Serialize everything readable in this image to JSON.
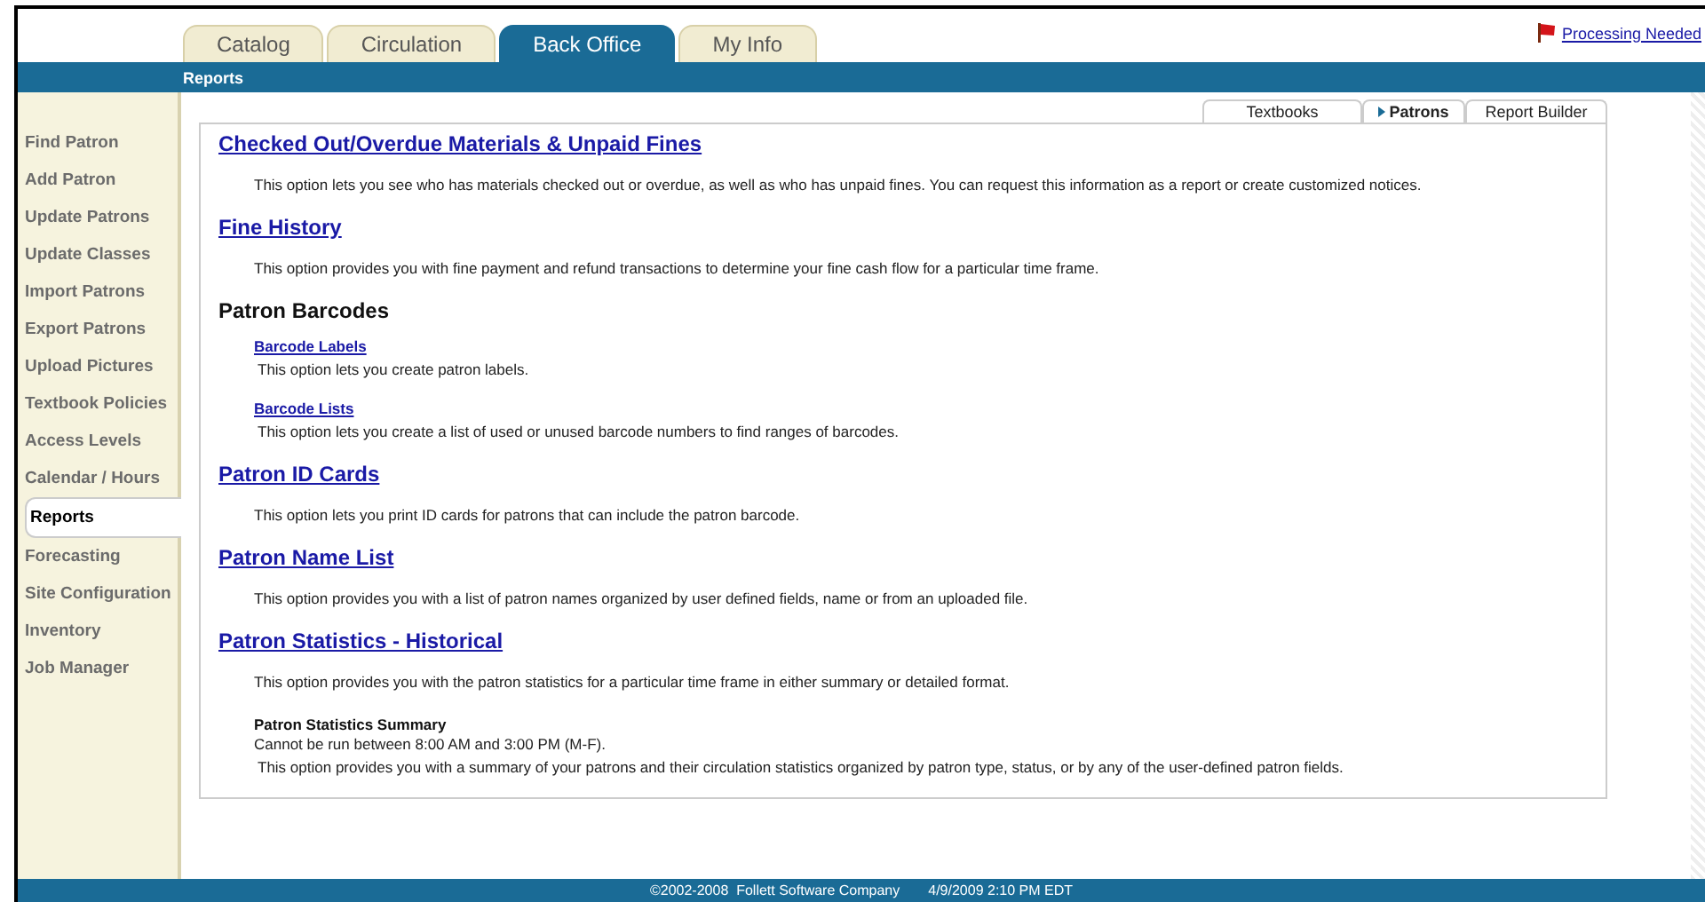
{
  "tabs": [
    {
      "label": "Catalog",
      "selected": false
    },
    {
      "label": "Circulation",
      "selected": false
    },
    {
      "label": "Back Office",
      "selected": true
    },
    {
      "label": "My Info",
      "selected": false
    }
  ],
  "alert_link": "Processing Needed",
  "subnav": "Reports",
  "sidebar": {
    "items": [
      {
        "label": "Find Patron",
        "selected": false
      },
      {
        "label": "Add Patron",
        "selected": false
      },
      {
        "label": "Update Patrons",
        "selected": false
      },
      {
        "label": "Update Classes",
        "selected": false
      },
      {
        "label": "Import Patrons",
        "selected": false
      },
      {
        "label": "Export Patrons",
        "selected": false
      },
      {
        "label": "Upload Pictures",
        "selected": false
      },
      {
        "label": "Textbook Policies",
        "selected": false
      },
      {
        "label": "Access Levels",
        "selected": false
      },
      {
        "label": "Calendar / Hours",
        "selected": false
      },
      {
        "label": "Reports",
        "selected": true
      },
      {
        "label": "Forecasting",
        "selected": false
      },
      {
        "label": "Site Configuration",
        "selected": false
      },
      {
        "label": "Inventory",
        "selected": false
      },
      {
        "label": "Job Manager",
        "selected": false
      }
    ]
  },
  "report_tabs": [
    {
      "label": "Textbooks",
      "selected": false
    },
    {
      "label": "Patrons",
      "selected": true
    },
    {
      "label": "Report Builder",
      "selected": false
    }
  ],
  "sections": [
    {
      "kind": "link",
      "title": "Checked Out/Overdue Materials & Unpaid Fines",
      "description": "This option lets you see who has materials checked out or overdue, as well as who has unpaid fines. You can request this information as a report or create customized notices."
    },
    {
      "kind": "link",
      "title": "Fine History",
      "description": "This option provides you with fine payment and refund transactions to determine your fine cash flow for a particular time frame."
    },
    {
      "kind": "group",
      "title": "Patron Barcodes",
      "children": [
        {
          "title": "Barcode Labels",
          "description": "This option lets you create patron labels."
        },
        {
          "title": "Barcode Lists",
          "description": "This option lets you create a list of used or unused barcode numbers to find ranges of barcodes."
        }
      ]
    },
    {
      "kind": "link",
      "title": "Patron ID Cards",
      "description": "This option lets you print ID cards for patrons that can include the patron barcode."
    },
    {
      "kind": "link",
      "title": "Patron Name List",
      "description": "This option provides you with a list of patron names organized by user defined fields, name or from an uploaded file."
    },
    {
      "kind": "link",
      "title": "Patron Statistics - Historical",
      "description": "This option provides you with the patron statistics for a particular time frame in either summary or detailed format.",
      "sub": {
        "title": "Patron Statistics Summary",
        "note": "Cannot be run between 8:00 AM and 3:00 PM (M-F).",
        "description": "This option provides you with a summary of your patrons and their circulation statistics organized by patron type, status, or by any of the user-defined patron fields."
      }
    }
  ],
  "footer": {
    "copyright": "©2002-2008  Follett Software Company",
    "timestamp": "4/9/2009 2:10 PM EDT"
  }
}
